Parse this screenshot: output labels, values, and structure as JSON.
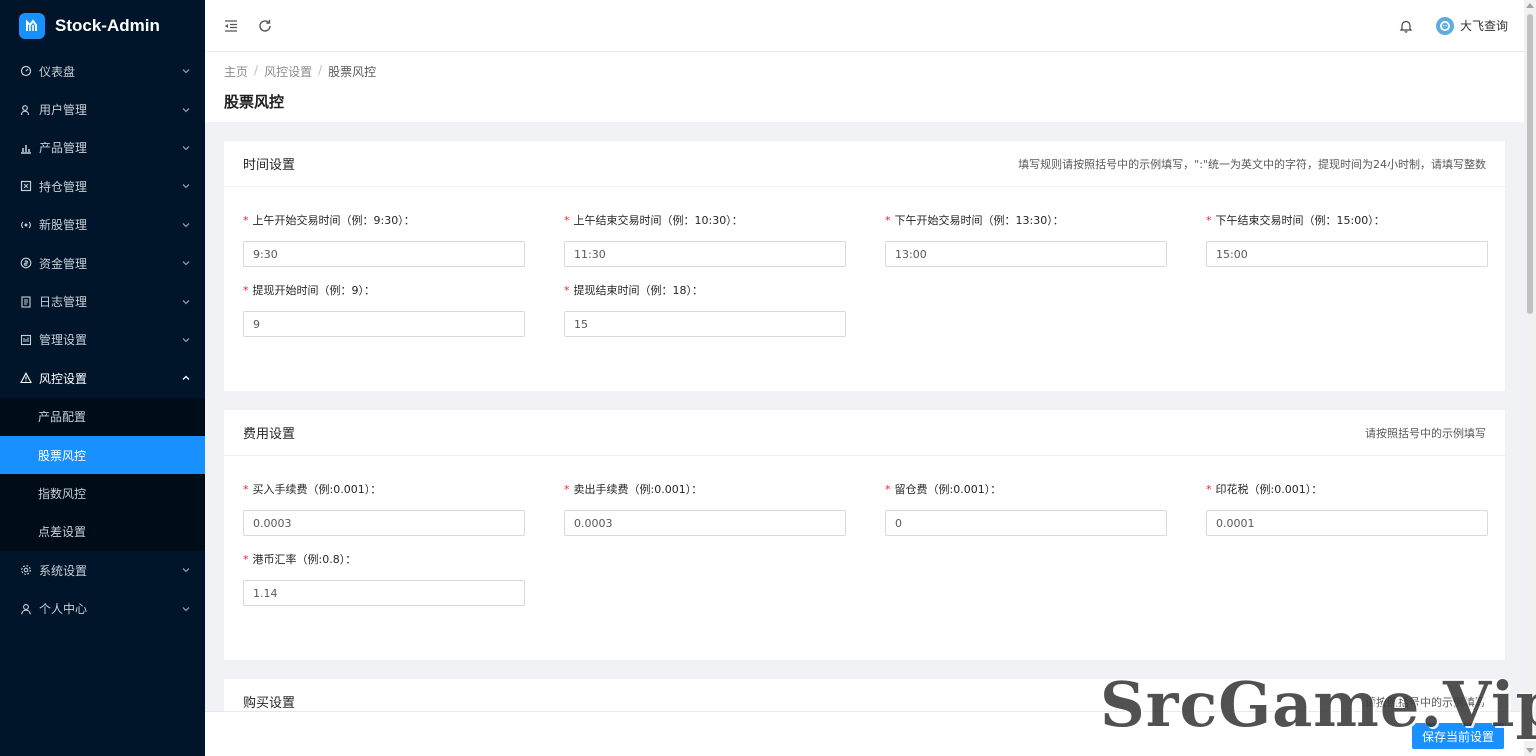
{
  "app": {
    "title": "Stock-Admin"
  },
  "sidebar": {
    "items": [
      {
        "label": "仪表盘",
        "icon": "dashboard-icon"
      },
      {
        "label": "用户管理",
        "icon": "user-manage-icon"
      },
      {
        "label": "产品管理",
        "icon": "chart-icon"
      },
      {
        "label": "持仓管理",
        "icon": "position-icon"
      },
      {
        "label": "新股管理",
        "icon": "ipo-icon"
      },
      {
        "label": "资金管理",
        "icon": "money-icon"
      },
      {
        "label": "日志管理",
        "icon": "log-icon"
      },
      {
        "label": "管理设置",
        "icon": "admin-settings-icon"
      },
      {
        "label": "风控设置",
        "icon": "warning-icon",
        "open": true
      },
      {
        "label": "系统设置",
        "icon": "gear-icon"
      },
      {
        "label": "个人中心",
        "icon": "person-icon"
      }
    ],
    "sub_items": [
      {
        "label": "产品配置"
      },
      {
        "label": "股票风控",
        "active": true
      },
      {
        "label": "指数风控"
      },
      {
        "label": "点差设置"
      }
    ]
  },
  "header": {
    "user_name": "大飞查询"
  },
  "breadcrumb": {
    "home": "主页",
    "parent": "风控设置",
    "current": "股票风控"
  },
  "page": {
    "title": "股票风控"
  },
  "time_settings": {
    "title": "时间设置",
    "hint": "填写规则请按照括号中的示例填写，\":\"统一为英文中的字符，提现时间为24小时制，请填写整数",
    "fields": [
      {
        "label": "上午开始交易时间（例：9:30）：",
        "value": "9:30"
      },
      {
        "label": "上午结束交易时间（例：10:30）：",
        "value": "11:30"
      },
      {
        "label": "下午开始交易时间（例：13:30）：",
        "value": "13:00"
      },
      {
        "label": "下午结束交易时间（例：15:00）：",
        "value": "15:00"
      },
      {
        "label": "提现开始时间（例：9）：",
        "value": "9"
      },
      {
        "label": "提现结束时间（例：18）：",
        "value": "15"
      }
    ]
  },
  "fee_settings": {
    "title": "费用设置",
    "hint": "请按照括号中的示例填写",
    "fields": [
      {
        "label": "买入手续费（例:0.001）：",
        "value": "0.0003"
      },
      {
        "label": "卖出手续费（例:0.001）：",
        "value": "0.0003"
      },
      {
        "label": "留仓费（例:0.001）：",
        "value": "0"
      },
      {
        "label": "印花税（例:0.001）：",
        "value": "0.0001"
      },
      {
        "label": "港币汇率（例:0.8）：",
        "value": "1.14"
      }
    ]
  },
  "buy_settings": {
    "title": "购买设置",
    "hint": "请按照括号中的示例填写"
  },
  "footer": {
    "save_label": "保存当前设置"
  },
  "watermark": {
    "text": "SrcGame.Vip"
  },
  "colors": {
    "sidebar_bg": "#001529",
    "accent": "#1890ff",
    "required": "#f5222d"
  }
}
